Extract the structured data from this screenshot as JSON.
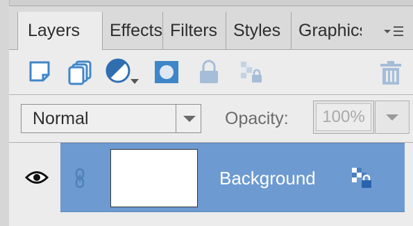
{
  "panel": {
    "tabs": [
      {
        "label": "Layers",
        "active": true
      },
      {
        "label": "Effects",
        "active": false
      },
      {
        "label": "Filters",
        "active": false
      },
      {
        "label": "Styles",
        "active": false
      },
      {
        "label": "Graphics",
        "active": false
      }
    ],
    "flyout_icon": "panel-menu-icon"
  },
  "toolbar": {
    "icons": [
      "new-layer-icon",
      "new-group-icon",
      "adjustment-layer-icon",
      "layer-mask-icon",
      "lock-all-icon",
      "lock-transparency-icon",
      "delete-layer-icon"
    ]
  },
  "blend": {
    "mode": "Normal",
    "opacity_label": "Opacity:",
    "opacity_value": "100%"
  },
  "layers": [
    {
      "name": "Background",
      "selected": true,
      "visible": true,
      "locked": true
    }
  ],
  "colors": {
    "selection": "#6d9bd1",
    "icon_blue": "#3f86c8"
  }
}
